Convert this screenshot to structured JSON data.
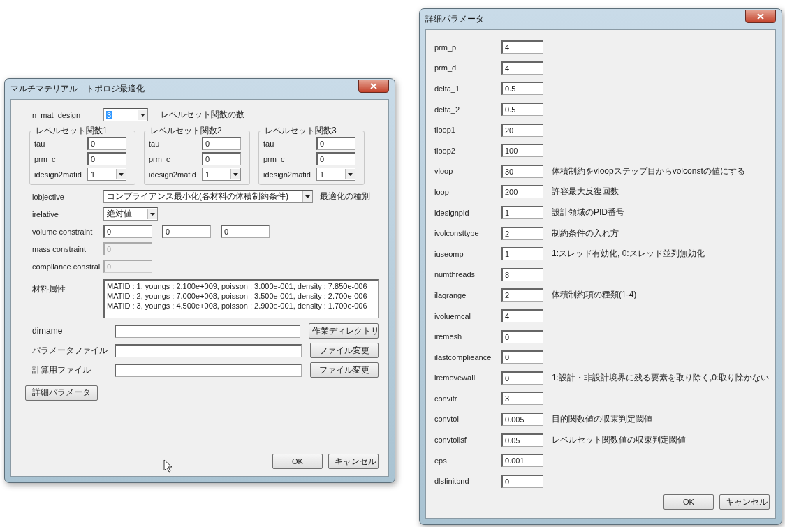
{
  "main_dialog": {
    "title": "マルチマテリアル　トポロジ最適化",
    "n_mat_design": {
      "label": "n_mat_design",
      "value": "3",
      "highlighted": true,
      "note": "レベルセット関数の数"
    },
    "level_sets": [
      {
        "title": "レベルセット関数1",
        "tau": {
          "label": "tau",
          "value": "0"
        },
        "prm_c": {
          "label": "prm_c",
          "value": "0"
        },
        "matid": {
          "label": "idesign2matid",
          "value": "1"
        }
      },
      {
        "title": "レベルセット関数2",
        "tau": {
          "label": "tau",
          "value": "0"
        },
        "prm_c": {
          "label": "prm_c",
          "value": "0"
        },
        "matid": {
          "label": "idesign2matid",
          "value": "1"
        }
      },
      {
        "title": "レベルセット関数3",
        "tau": {
          "label": "tau",
          "value": "0"
        },
        "prm_c": {
          "label": "prm_c",
          "value": "0"
        },
        "matid": {
          "label": "idesign2matid",
          "value": "1"
        }
      }
    ],
    "objective": {
      "label": "iobjective",
      "value": "コンプライアンス最小化(各材料の体積制約条件)",
      "note": "最適化の種別"
    },
    "relative": {
      "label": "irelative",
      "value": "絶対値"
    },
    "constraints": [
      {
        "label": "volume constraint",
        "values": [
          "0",
          "0",
          "0"
        ],
        "disabled": false
      },
      {
        "label": "mass constraint",
        "values": [
          "0"
        ],
        "disabled": true
      },
      {
        "label": "compliance constrai",
        "values": [
          "0"
        ],
        "disabled": true
      }
    ],
    "materials": {
      "label": "材料属性",
      "lines": [
        "MATID :  1, youngs : 2.100e+009, poisson : 3.000e-001, density : 7.850e-006",
        "MATID :  2, youngs : 7.000e+008, poisson : 3.500e-001, density : 2.700e-006",
        "MATID :  3, youngs : 4.500e+008, poisson : 2.900e-001, density : 1.700e-006"
      ]
    },
    "files": [
      {
        "label": "dirname",
        "button": "作業ディレクトリ"
      },
      {
        "label": "パラメータファイル",
        "button": "ファイル変更"
      },
      {
        "label": "計算用ファイル",
        "button": "ファイル変更"
      }
    ],
    "detail_button": "詳細パラメータ",
    "ok_button": "OK",
    "cancel_button": "キャンセル"
  },
  "detail_dialog": {
    "title": "詳細パラメータ",
    "params": [
      {
        "label": "prm_p",
        "value": "4"
      },
      {
        "label": "prm_d",
        "value": "4"
      },
      {
        "label": "delta_1",
        "value": "0.5"
      },
      {
        "label": "delta_2",
        "value": "0.5"
      },
      {
        "label": "tloop1",
        "value": "20"
      },
      {
        "label": "tloop2",
        "value": "100"
      },
      {
        "label": "vloop",
        "value": "30",
        "note": "体積制約をvloopステップ目からvolconstの値にする"
      },
      {
        "label": "loop",
        "value": "200",
        "note": "許容最大反復回数"
      },
      {
        "label": "idesignpid",
        "value": "1",
        "note": "設計領域のPID番号"
      },
      {
        "label": "ivolconsttype",
        "value": "2",
        "note": "制約条件の入れ方"
      },
      {
        "label": "iuseomp",
        "value": "1",
        "note": "1:スレッド有効化, 0:スレッド並列無効化"
      },
      {
        "label": "numthreads",
        "value": "8"
      },
      {
        "label": "ilagrange",
        "value": "2",
        "note": "体積制約項の種類(1-4)"
      },
      {
        "label": "ivoluemcal",
        "value": "4"
      },
      {
        "label": "iremesh",
        "value": "0"
      },
      {
        "label": "ilastcomplieance",
        "value": "0"
      },
      {
        "label": "iremovewall",
        "value": "0",
        "note": "1:設計・非設計境界に残る要素を取り除く,0:取り除かない"
      },
      {
        "label": "convitr",
        "value": "3"
      },
      {
        "label": "convtol",
        "value": "0.005",
        "note": "目的関数値の収束判定閾値"
      },
      {
        "label": "convtollsf",
        "value": "0.05",
        "note": "レベルセット関数値の収束判定閾値"
      },
      {
        "label": "eps",
        "value": "0.001"
      },
      {
        "label": "dlsfinitbnd",
        "value": "0"
      }
    ],
    "ok_button": "OK",
    "cancel_button": "キャンセル"
  }
}
